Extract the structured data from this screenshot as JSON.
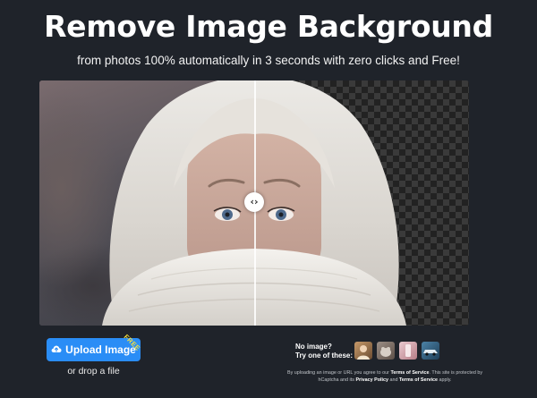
{
  "hero": {
    "title": "Remove Image Background",
    "subtitle": "from photos 100% automatically in 3 seconds with zero clicks and Free!"
  },
  "comparison": {
    "handle_glyph": "‹›",
    "handle_icon": "chevrons-left-right-icon"
  },
  "upload": {
    "button_label": "Upload Image",
    "button_icon": "upload-cloud-icon",
    "free_badge": "FREE",
    "drop_text": "or drop a file",
    "accent_color": "#2a8df6",
    "badge_color": "#f7e03c"
  },
  "samples": {
    "line1": "No image?",
    "line2": "Try one of these:",
    "thumbnails": [
      "sample-person",
      "sample-animal",
      "sample-product",
      "sample-car"
    ]
  },
  "legal": {
    "part1": "By uploading an image or URL you agree to our ",
    "tos1": "Terms of Service",
    "part2": ". This site is protected by hCaptcha and its ",
    "privacy": "Privacy Policy",
    "part3": " and ",
    "tos2": "Terms of Service",
    "part4": " apply."
  },
  "colors": {
    "background": "#1f232a"
  }
}
